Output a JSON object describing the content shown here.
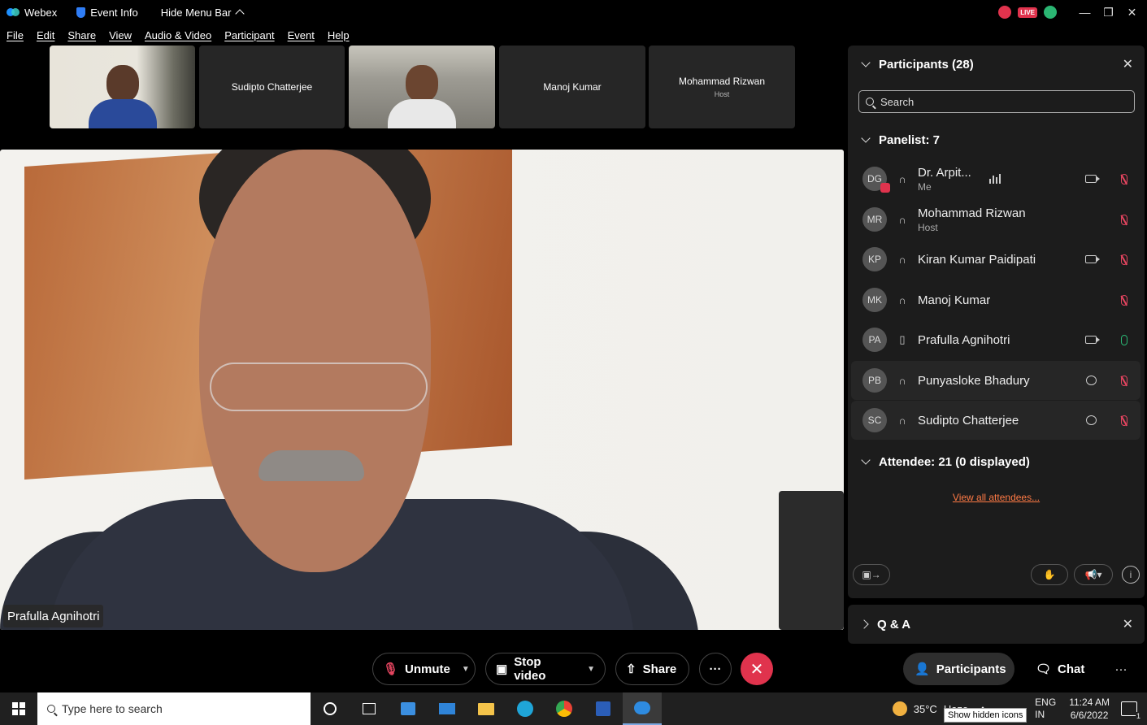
{
  "titlebar": {
    "app_name": "Webex",
    "event_info": "Event Info",
    "hide_menu": "Hide Menu Bar",
    "live_label": "LIVE"
  },
  "menu": [
    "File",
    "Edit",
    "Share",
    "View",
    "Audio & Video",
    "Participant",
    "Event",
    "Help"
  ],
  "thumbnails": [
    {
      "name": "",
      "sub": "",
      "video": true
    },
    {
      "name": "Sudipto Chatterjee",
      "sub": "",
      "video": false
    },
    {
      "name": "",
      "sub": "",
      "video": true
    },
    {
      "name": "Manoj Kumar",
      "sub": "",
      "video": false
    },
    {
      "name": "Mohammad Rizwan",
      "sub": "Host",
      "video": false
    }
  ],
  "main_video": {
    "speaker_name": "Prafulla Agnihotri"
  },
  "participants_panel": {
    "title": "Participants (28)",
    "search_placeholder": "Search",
    "panelist_header": "Panelist: 7",
    "panelists": [
      {
        "initials": "DG",
        "name": "Dr. Arpit...",
        "role": "Me",
        "device": "headset-icon",
        "camera": true,
        "chat": false,
        "mic_muted": true,
        "speaking_bars": true
      },
      {
        "initials": "MR",
        "name": "Mohammad Rizwan",
        "role": "Host",
        "device": "headset-icon",
        "camera": false,
        "chat": false,
        "mic_muted": true
      },
      {
        "initials": "KP",
        "name": "Kiran Kumar Paidipati",
        "role": "",
        "device": "headset-icon",
        "camera": true,
        "chat": false,
        "mic_muted": true
      },
      {
        "initials": "MK",
        "name": "Manoj Kumar",
        "role": "",
        "device": "headset-icon",
        "camera": false,
        "chat": false,
        "mic_muted": true
      },
      {
        "initials": "PA",
        "name": "Prafulla Agnihotri",
        "role": "",
        "device": "phone-icon",
        "camera": true,
        "chat": false,
        "mic_muted": false
      },
      {
        "initials": "PB",
        "name": "Punyasloke Bhadury",
        "role": "",
        "device": "headset-icon",
        "camera": false,
        "chat": true,
        "mic_muted": true
      },
      {
        "initials": "SC",
        "name": "Sudipto Chatterjee",
        "role": "",
        "device": "headset-icon",
        "camera": false,
        "chat": true,
        "mic_muted": true
      }
    ],
    "attendee_header": "Attendee: 21 (0 displayed)",
    "view_all": "View all attendees..."
  },
  "qa_panel": {
    "title": "Q & A"
  },
  "controls": {
    "unmute": "Unmute",
    "stop_video": "Stop video",
    "share": "Share",
    "more": "···",
    "participants_tab": "Participants",
    "chat_tab": "Chat"
  },
  "taskbar": {
    "search_placeholder": "Type here to search",
    "weather_temp": "35°C",
    "weather_text": "Haze",
    "lang1": "ENG",
    "lang2": "IN",
    "time": "11:24 AM",
    "date": "6/6/2022",
    "tooltip": "Show hidden icons",
    "notif_count": "1"
  },
  "colors": {
    "accent_red": "#e0334d",
    "link_orange": "#ff7a45",
    "mic_on_green": "#2bb673"
  }
}
